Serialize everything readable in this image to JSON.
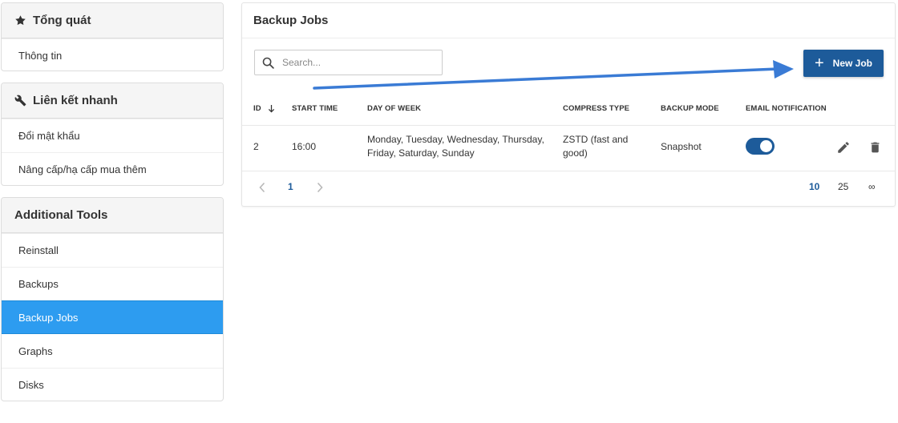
{
  "sidebar": {
    "general": {
      "title": "Tổng quát",
      "icon": "star-icon",
      "items": [
        "Thông tin"
      ]
    },
    "quick_links": {
      "title": "Liên kết nhanh",
      "icon": "wrench-icon",
      "items": [
        "Đổi mật khẩu",
        "Nâng cấp/hạ cấp mua thêm"
      ]
    },
    "additional_tools": {
      "title": "Additional Tools",
      "items": [
        "Reinstall",
        "Backups",
        "Backup Jobs",
        "Graphs",
        "Disks"
      ],
      "active": "Backup Jobs"
    }
  },
  "main": {
    "title": "Backup Jobs",
    "search": {
      "placeholder": "Search...",
      "value": ""
    },
    "new_job_label": "New Job",
    "table": {
      "columns": [
        "ID",
        "START TIME",
        "DAY OF WEEK",
        "COMPRESS TYPE",
        "BACKUP MODE",
        "EMAIL NOTIFICATION"
      ],
      "sort_column": "ID",
      "sort_direction": "descending",
      "rows": [
        {
          "id": "2",
          "start_time": "16:00",
          "day_of_week_line1": "Monday, Tuesday, Wednesday, Thursday,",
          "day_of_week_line2": "Friday, Saturday, Sunday",
          "compress_type_line1": "ZSTD (fast and",
          "compress_type_line2": "good)",
          "backup_mode": "Snapshot",
          "email_notification": true
        }
      ]
    },
    "pagination": {
      "current_page": "1",
      "page_sizes": [
        "10",
        "25",
        "∞"
      ],
      "selected_page_size": "10"
    }
  },
  "colors": {
    "primary": "#1d5b9a",
    "sidebar_active": "#2d9cf0",
    "annotation_arrow": "#3a7bd5"
  }
}
